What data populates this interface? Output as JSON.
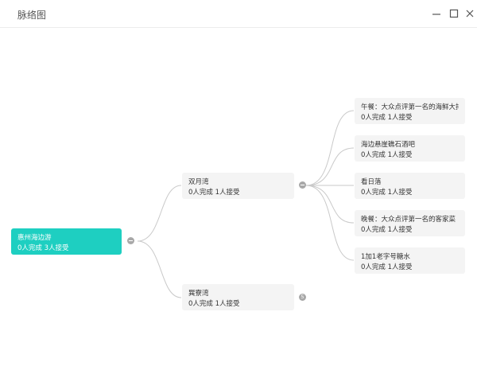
{
  "window": {
    "title": "脉络图"
  },
  "root": {
    "name": "惠州海边游",
    "stats": "0人完成 3人接受"
  },
  "branches": [
    {
      "name": "双月湾",
      "stats": "0人完成 1人接受",
      "children": [
        {
          "name": "午餐：大众点评第一名的海鲜大排档",
          "stats": "0人完成 1人接受"
        },
        {
          "name": "海边悬崖礁石酒吧",
          "stats": "0人完成 1人接受"
        },
        {
          "name": "看日落",
          "stats": "0人完成 1人接受"
        },
        {
          "name": "晚餐：大众点评第一名的客家菜",
          "stats": "0人完成 1人接受"
        },
        {
          "name": "1加1老字号糖水",
          "stats": "0人完成 1人接受"
        }
      ]
    },
    {
      "name": "巽寮湾",
      "stats": "0人完成 1人接受",
      "collapsed_count": "5"
    }
  ],
  "colors": {
    "root": "#1ecfc1",
    "node": "#f4f4f4",
    "line": "#c9c9c9",
    "toggle": "#a8a8a8"
  }
}
